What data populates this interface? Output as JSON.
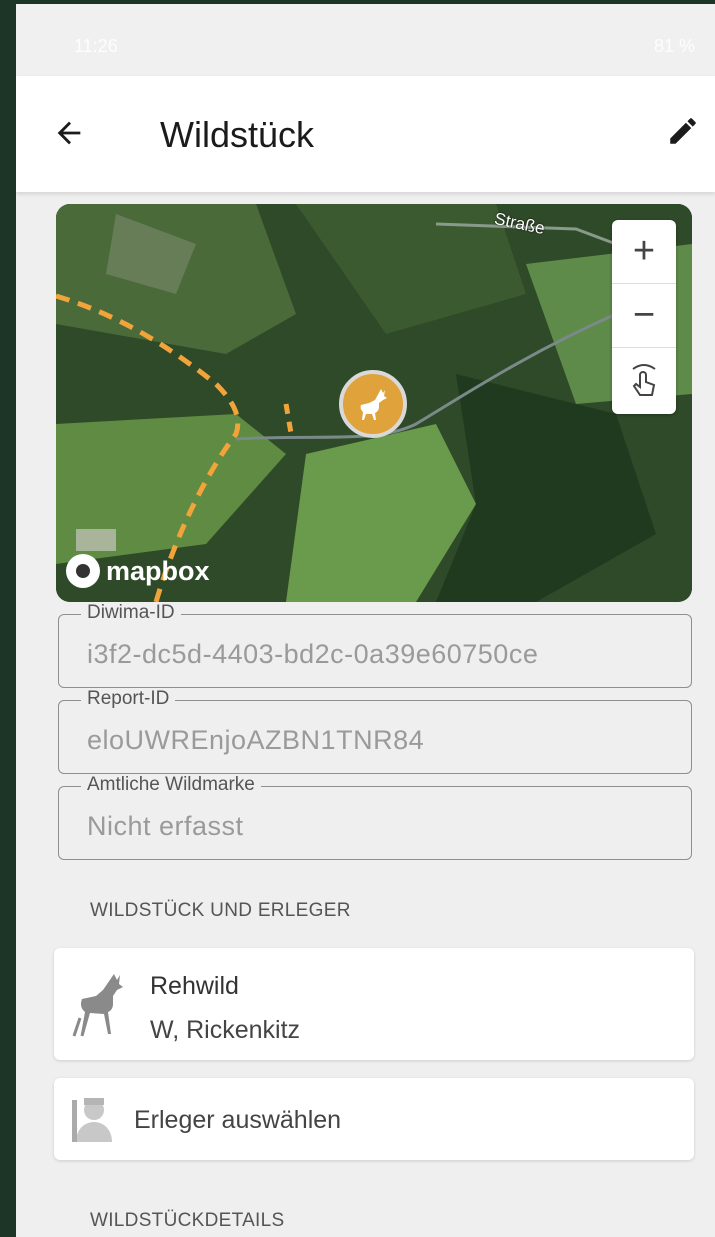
{
  "status": {
    "time": "11:26",
    "battery": "81 %"
  },
  "header": {
    "title": "Wildstück"
  },
  "map": {
    "street_label": "Straße",
    "zoom_in": "+",
    "zoom_out": "−",
    "attribution": "mapbox",
    "marker_color": "#e0a23a"
  },
  "fields": [
    {
      "label": "Diwima-ID",
      "value": "i3f2-dc5d-4403-bd2c-0a39e60750ce"
    },
    {
      "label": "Report-ID",
      "value": "eloUWREnjoAZBN1TNR84"
    },
    {
      "label": "Amtliche Wildmarke",
      "value": "Nicht erfasst"
    }
  ],
  "sections": {
    "game_and_hunter": "WILDSTÜCK UND ERLEGER",
    "game_details": "WILDSTÜCKDETAILS"
  },
  "game_card": {
    "species": "Rehwild",
    "detail": "W, Rickenkitz"
  },
  "hunter_card": {
    "label": "Erleger auswählen"
  },
  "icons": {
    "back": "arrow-left-icon",
    "edit": "pencil-icon",
    "deer": "deer-icon",
    "hunter": "person-icon",
    "gesture": "touch-rotate-icon"
  }
}
